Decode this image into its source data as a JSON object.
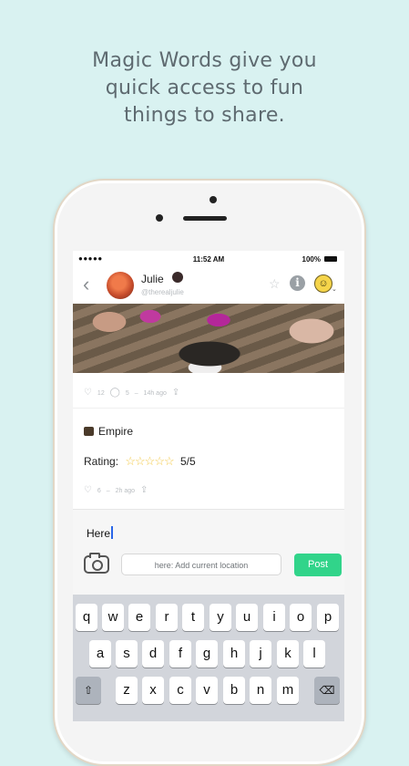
{
  "headline": {
    "line1": "Magic Words give you",
    "line2": "quick access to fun",
    "line3": "things to share."
  },
  "status_bar": {
    "signal": "●●●●● ",
    "time": "11:52 AM",
    "battery": "100%"
  },
  "header": {
    "back_icon": "‹",
    "name": "Julie",
    "handle": "@therealjulie",
    "star_icon": "☆",
    "info_icon": "i",
    "smile_icon": "☺",
    "chevron_icon": "⌄"
  },
  "post1": {
    "likes": "12",
    "comments": "5",
    "time": "14h ago"
  },
  "magic_post": {
    "title": "Empire",
    "rating_label": "Rating:",
    "stars": "☆☆☆☆☆",
    "score": "5/5",
    "likes": "6",
    "time": "2h ago"
  },
  "compose": {
    "text": "Here",
    "location_button": "here: Add current location",
    "post_button": "Post"
  },
  "keyboard": {
    "row1": [
      "q",
      "w",
      "e",
      "r",
      "t",
      "y",
      "u",
      "i",
      "o",
      "p"
    ],
    "row2": [
      "a",
      "s",
      "d",
      "f",
      "g",
      "h",
      "j",
      "k",
      "l"
    ],
    "row3": [
      "z",
      "x",
      "c",
      "v",
      "b",
      "n",
      "m"
    ],
    "shift": "⇧",
    "delete": "⌫"
  },
  "colors": {
    "background": "#d9f2f1",
    "accent_green": "#31d48a",
    "star_gold": "#f3c948",
    "cursor_blue": "#2a66e8"
  }
}
